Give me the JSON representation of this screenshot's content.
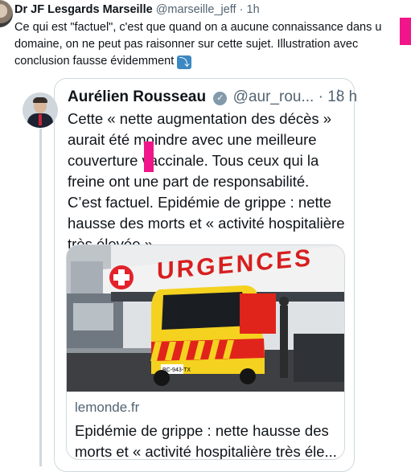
{
  "tweet": {
    "author_name": "Dr JF Lesgards Marseille",
    "handle": "@marseille_jeff",
    "separator": "·",
    "time": "1h",
    "text": "Ce qui est \"factuel\", c'est que quand on a aucune connaissance dans u domaine, on ne peut pas raisonner sur cette sujet. Illustration avec conclusion fausse évidemment",
    "emoji": "⤵"
  },
  "quoted": {
    "author_name": "Aurélien Rousseau",
    "verified_icon": "verified-badge-icon",
    "handle": "@aur_rou...",
    "separator": "·",
    "time": "18 h",
    "more": "⋮",
    "text": "Cette « nette augmentation des décès » aurait été moindre avec une meilleure couverture vaccinale. Tous ceux qui la freine ont une part de responsabilité. C’est factuel. Epidémie de grippe : nette hausse des morts et « activité hospitalière très élevée »",
    "link": {
      "domain": "lemonde.fr",
      "title": "Epidémie de grippe : nette hausse des morts et « activité hospitalière très éle...",
      "image": {
        "sign": "URGENCES",
        "plate": "BC-943-TX"
      }
    }
  },
  "colors": {
    "highlight": "#f0168a",
    "link_gray": "#536471",
    "border": "#cfd9de"
  }
}
